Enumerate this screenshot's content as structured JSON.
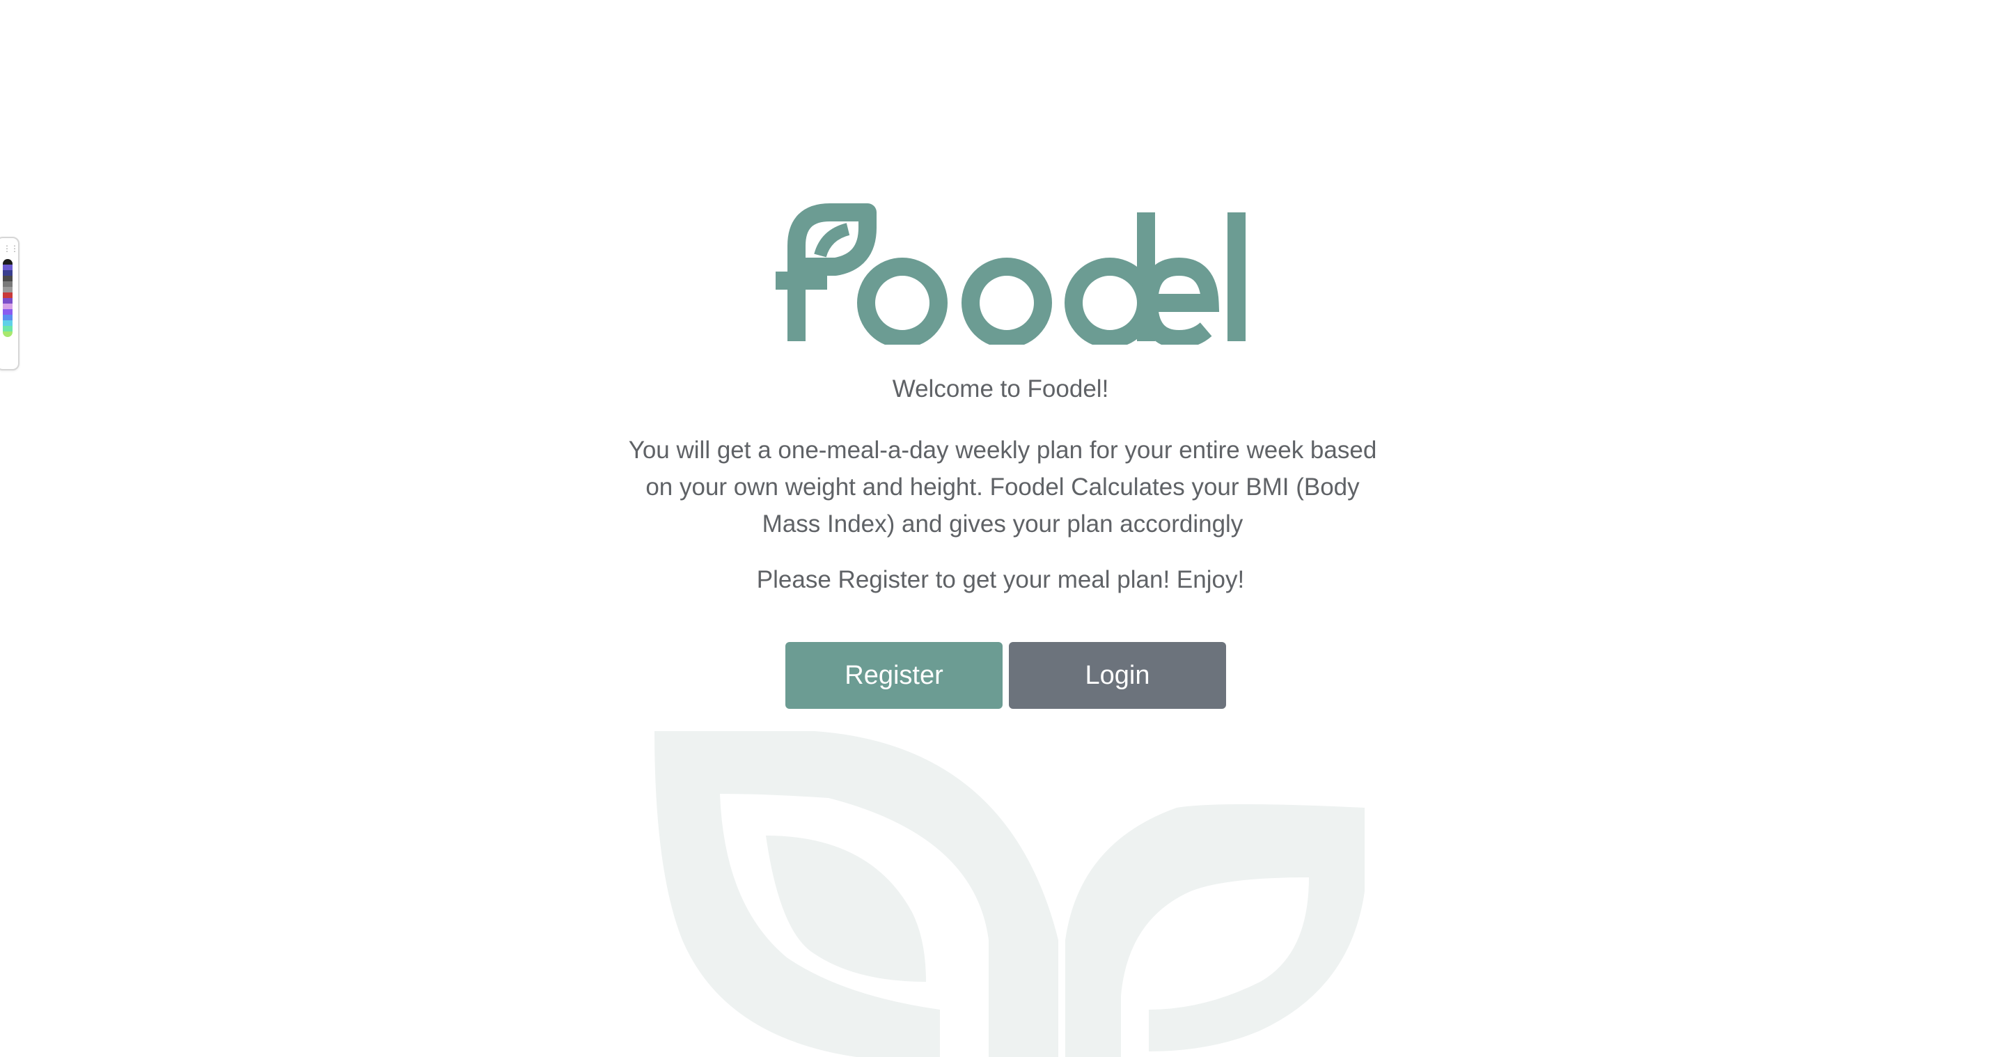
{
  "brand": {
    "logo_text": "Foodel",
    "accent_color": "#6c9c93",
    "background_leaf_color": "#eef2f1"
  },
  "hero": {
    "welcome": "Welcome to Foodel!",
    "description": "You will get a one-meal-a-day weekly plan for your entire week based on your own weight and height. Foodel Calculates your BMI (Body Mass Index) and gives your plan accordingly",
    "cta_text": "Please Register to get your meal plan! Enjoy!"
  },
  "actions": {
    "register_label": "Register",
    "register_color": "#6c9c93",
    "login_label": "Login",
    "login_color": "#6c737c"
  },
  "palette_widget": {
    "handle_icon": "drag-handle-icon",
    "swatches": [
      "#1c1c1c",
      "#6b5bd0",
      "#3a3f8f",
      "#4a4a4a",
      "#7a7a7a",
      "#9a9a9a",
      "#c93a3a",
      "#7b4fc9",
      "#d6a2e8",
      "#8a5cf0",
      "#5b8ef0",
      "#5fd0e8",
      "#6ee6a8",
      "#a8e86e"
    ]
  }
}
